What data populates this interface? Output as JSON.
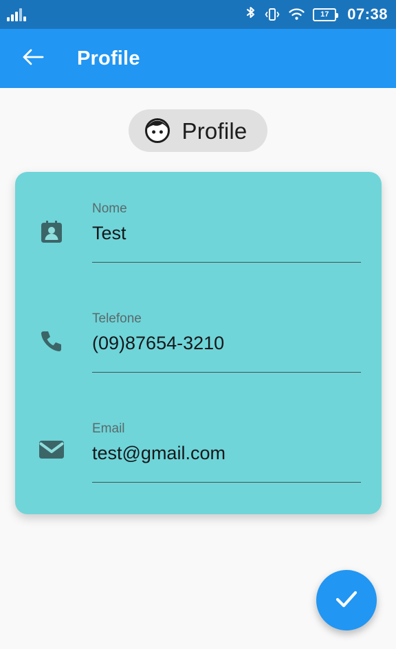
{
  "status_bar": {
    "signal_icon": "cellular-signal-icon",
    "bluetooth_icon": "bluetooth-icon",
    "vibrate_icon": "vibrate-mode-icon",
    "wifi_icon": "wifi-icon",
    "battery_icon": "battery-icon",
    "battery_level": "17",
    "time": "07:38",
    "background_color": "#1A74BC"
  },
  "app_bar": {
    "back_icon": "arrow-back-icon",
    "title": "Profile",
    "background_color": "#2196F3"
  },
  "chip": {
    "icon": "person-face-icon",
    "label": "Profile",
    "background_color": "#E0E0E0"
  },
  "card": {
    "background_color": "#6FD5D9",
    "fields": [
      {
        "icon": "contact-badge-icon",
        "label": "Nome",
        "value": "Test"
      },
      {
        "icon": "phone-icon",
        "label": "Telefone",
        "value": "(09)87654-3210"
      },
      {
        "icon": "email-envelope-icon",
        "label": "Email",
        "value": "test@gmail.com"
      }
    ]
  },
  "fab": {
    "icon": "check-icon",
    "background_color": "#2196F3"
  },
  "page": {
    "background_color": "#F9F9F9"
  }
}
